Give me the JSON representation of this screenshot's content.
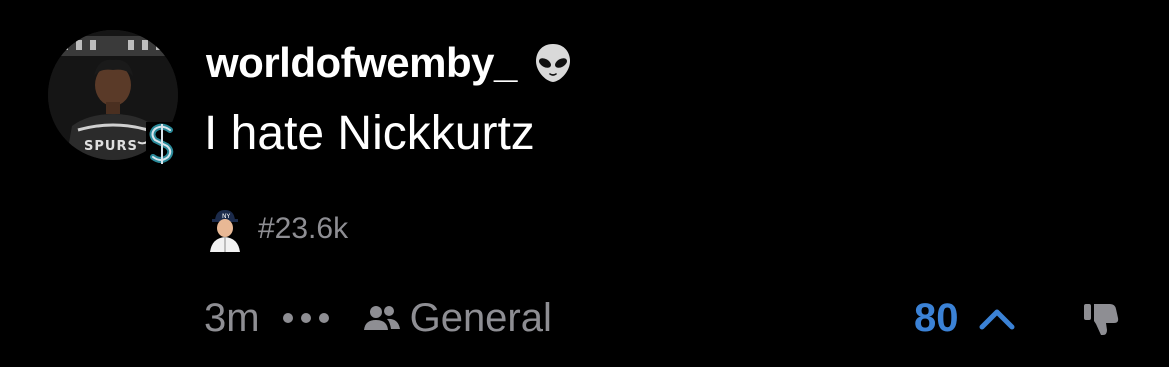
{
  "post": {
    "username": "worldofwemby_",
    "username_emoji_icon": "alien-icon",
    "avatar_badge_text": "SPURS",
    "text": "I hate Nickkurtz",
    "tag": "#23.6k",
    "time": "3m",
    "community": "General",
    "vote_count": "80"
  },
  "colors": {
    "background": "#000000",
    "primary_text": "#ffffff",
    "secondary_text": "#8e8e93",
    "accent": "#3b82d6"
  }
}
